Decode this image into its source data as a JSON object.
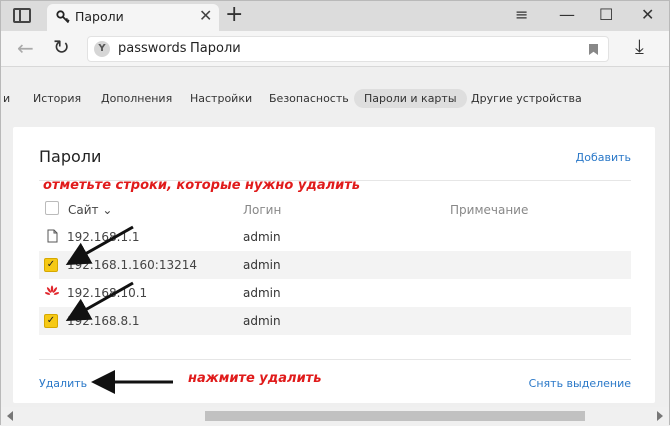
{
  "tab": {
    "title": "Пароли",
    "close": "✕",
    "new_tab": "+"
  },
  "window_controls": {
    "menu": "≡",
    "minimize": "—",
    "maximize": "☐",
    "close": "✕"
  },
  "address": {
    "domain": "passwords",
    "title": "Пароли"
  },
  "settings_nav": [
    {
      "label": "и"
    },
    {
      "label": "История"
    },
    {
      "label": "Дополнения"
    },
    {
      "label": "Настройки"
    },
    {
      "label": "Безопасность"
    },
    {
      "label": "Пароли и карты"
    },
    {
      "label": "Другие устройства"
    }
  ],
  "card": {
    "title": "Пароли",
    "add_link": "Добавить",
    "hint_top": "отметьте строки, которые нужно удалить",
    "columns": {
      "site": "Сайт ⌄",
      "login": "Логин",
      "note": "Примечание"
    },
    "rows": [
      {
        "site": "192.168.1.1",
        "login": "admin",
        "checked": false,
        "icon": "file-icon"
      },
      {
        "site": "192.168.1.160:13214",
        "login": "admin",
        "checked": true,
        "icon": "checkbox-checked"
      },
      {
        "site": "192.168.10.1",
        "login": "admin",
        "checked": false,
        "icon": "huawei-icon"
      },
      {
        "site": "192.168.8.1",
        "login": "admin",
        "checked": true,
        "icon": "checkbox-checked"
      }
    ],
    "delete_link": "Удалить",
    "hint_bottom": "нажмите удалить",
    "clear_link": "Снять выделение"
  },
  "colors": {
    "accent_link": "#2a78c8",
    "hint_red": "#e01b1b",
    "checkbox_yellow": "#f6c915"
  }
}
